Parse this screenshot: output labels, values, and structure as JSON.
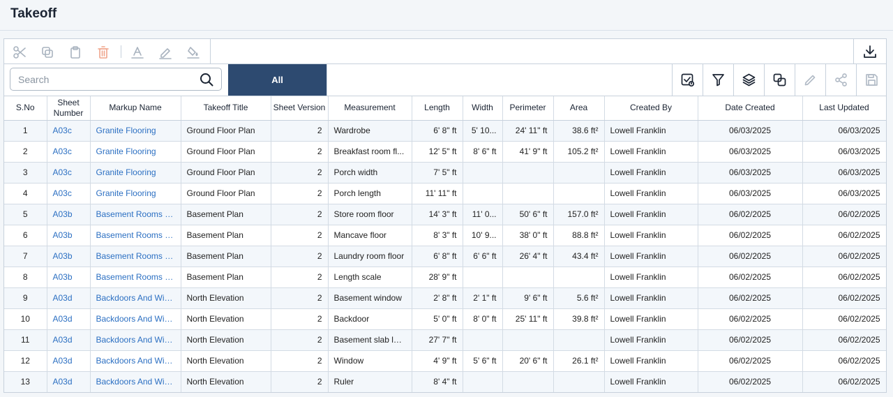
{
  "page": {
    "title": "Takeoff"
  },
  "toolbar": {
    "tools": [
      {
        "name": "scissors-icon",
        "label": "Cut"
      },
      {
        "name": "copy-icon",
        "label": "Copy"
      },
      {
        "name": "clipboard-icon",
        "label": "Paste"
      },
      {
        "name": "trash-icon",
        "label": "Delete"
      },
      {
        "name": "text-color-icon",
        "label": "Text color"
      },
      {
        "name": "pen-icon",
        "label": "Line color"
      },
      {
        "name": "fill-icon",
        "label": "Fill color"
      }
    ],
    "download_icon": "download-icon"
  },
  "search": {
    "placeholder": "Search"
  },
  "filter": {
    "all_label": "All"
  },
  "right_tools": [
    "status-check-icon",
    "filter-icon",
    "layers-icon",
    "duplicate-icon",
    "pencil-icon",
    "share-icon",
    "save-icon"
  ],
  "table": {
    "columns": [
      "S.No",
      "Sheet Number",
      "Markup Name",
      "Takeoff Title",
      "Sheet Version",
      "Measurement",
      "Length",
      "Width",
      "Perimeter",
      "Area",
      "Created By",
      "Date Created",
      "Last Updated"
    ],
    "rows": [
      [
        "1",
        "A03c",
        "Granite Flooring",
        "Ground Floor Plan",
        "2",
        "Wardrobe",
        "6' 8\" ft",
        "5' 10...",
        "24' 11\" ft",
        "38.6 ft²",
        "Lowell Franklin",
        "06/03/2025",
        "06/03/2025"
      ],
      [
        "2",
        "A03c",
        "Granite Flooring",
        "Ground Floor Plan",
        "2",
        "Breakfast room fl...",
        "12' 5\" ft",
        "8' 6\" ft",
        "41' 9\" ft",
        "105.2 ft²",
        "Lowell Franklin",
        "06/03/2025",
        "06/03/2025"
      ],
      [
        "3",
        "A03c",
        "Granite Flooring",
        "Ground Floor Plan",
        "2",
        "Porch width",
        "7' 5\" ft",
        "",
        "",
        "",
        "Lowell Franklin",
        "06/03/2025",
        "06/03/2025"
      ],
      [
        "4",
        "A03c",
        "Granite Flooring",
        "Ground Floor Plan",
        "2",
        "Porch length",
        "11' 11\" ft",
        "",
        "",
        "",
        "Lowell Franklin",
        "06/03/2025",
        "06/03/2025"
      ],
      [
        "5",
        "A03b",
        "Basement Rooms Fl...",
        "Basement Plan",
        "2",
        "Store room floor",
        "14' 3\" ft",
        "11' 0...",
        "50' 6\" ft",
        "157.0 ft²",
        "Lowell Franklin",
        "06/02/2025",
        "06/02/2025"
      ],
      [
        "6",
        "A03b",
        "Basement Rooms Fl...",
        "Basement Plan",
        "2",
        "Mancave floor",
        "8' 3\" ft",
        "10' 9...",
        "38' 0\" ft",
        "88.8 ft²",
        "Lowell Franklin",
        "06/02/2025",
        "06/02/2025"
      ],
      [
        "7",
        "A03b",
        "Basement Rooms Fl...",
        "Basement Plan",
        "2",
        "Laundry room floor",
        "6' 8\" ft",
        "6' 6\" ft",
        "26' 4\" ft",
        "43.4 ft²",
        "Lowell Franklin",
        "06/02/2025",
        "06/02/2025"
      ],
      [
        "8",
        "A03b",
        "Basement Rooms Fl...",
        "Basement Plan",
        "2",
        "Length scale",
        "28' 9\" ft",
        "",
        "",
        "",
        "Lowell Franklin",
        "06/02/2025",
        "06/02/2025"
      ],
      [
        "9",
        "A03d",
        "Backdoors And Win...",
        "North Elevation",
        "2",
        "Basement window",
        "2' 8\" ft",
        "2' 1\" ft",
        "9' 6\" ft",
        "5.6 ft²",
        "Lowell Franklin",
        "06/02/2025",
        "06/02/2025"
      ],
      [
        "10",
        "A03d",
        "Backdoors And Win...",
        "North Elevation",
        "2",
        "Backdoor",
        "5' 0\" ft",
        "8' 0\" ft",
        "25' 11\" ft",
        "39.8 ft²",
        "Lowell Franklin",
        "06/02/2025",
        "06/02/2025"
      ],
      [
        "11",
        "A03d",
        "Backdoors And Win...",
        "North Elevation",
        "2",
        "Basement slab len...",
        "27' 7\" ft",
        "",
        "",
        "",
        "Lowell Franklin",
        "06/02/2025",
        "06/02/2025"
      ],
      [
        "12",
        "A03d",
        "Backdoors And Win...",
        "North Elevation",
        "2",
        "Window",
        "4' 9\" ft",
        "5' 6\" ft",
        "20' 6\" ft",
        "26.1 ft²",
        "Lowell Franklin",
        "06/02/2025",
        "06/02/2025"
      ],
      [
        "13",
        "A03d",
        "Backdoors And Win...",
        "North Elevation",
        "2",
        "Ruler",
        "8' 4\" ft",
        "",
        "",
        "",
        "Lowell Franklin",
        "06/02/2025",
        "06/02/2025"
      ]
    ]
  },
  "colors": {
    "accent": "#2d4a70",
    "link": "#2b6fc2",
    "stripe": "#f3f7fb",
    "border": "#c7d1dc"
  }
}
